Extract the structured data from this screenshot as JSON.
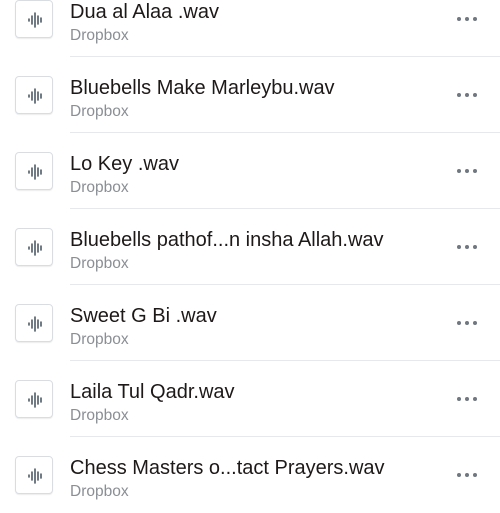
{
  "files": [
    {
      "name": "Dua al Alaa .wav",
      "source": "Dropbox",
      "icon": "audio-file-icon",
      "more_icon": "more-icon"
    },
    {
      "name": "Bluebells Make Marleybu.wav",
      "source": "Dropbox",
      "icon": "audio-file-icon",
      "more_icon": "more-icon"
    },
    {
      "name": "Lo Key .wav",
      "source": "Dropbox",
      "icon": "audio-file-icon",
      "more_icon": "more-icon"
    },
    {
      "name": "Bluebells pathof...n insha Allah.wav",
      "source": "Dropbox",
      "icon": "audio-file-icon",
      "more_icon": "more-icon"
    },
    {
      "name": "Sweet G Bi .wav",
      "source": "Dropbox",
      "icon": "audio-file-icon",
      "more_icon": "more-icon"
    },
    {
      "name": "Laila Tul Qadr.wav",
      "source": "Dropbox",
      "icon": "audio-file-icon",
      "more_icon": "more-icon"
    },
    {
      "name": "Chess Masters o...tact Prayers.wav",
      "source": "Dropbox",
      "icon": "audio-file-icon",
      "more_icon": "more-icon"
    }
  ],
  "colors": {
    "icon_waveform": "#4e5a66",
    "text_primary": "#1e1919",
    "text_secondary": "#8a8f95",
    "divider": "#e6e8eb",
    "more_dots": "#6f7780"
  }
}
